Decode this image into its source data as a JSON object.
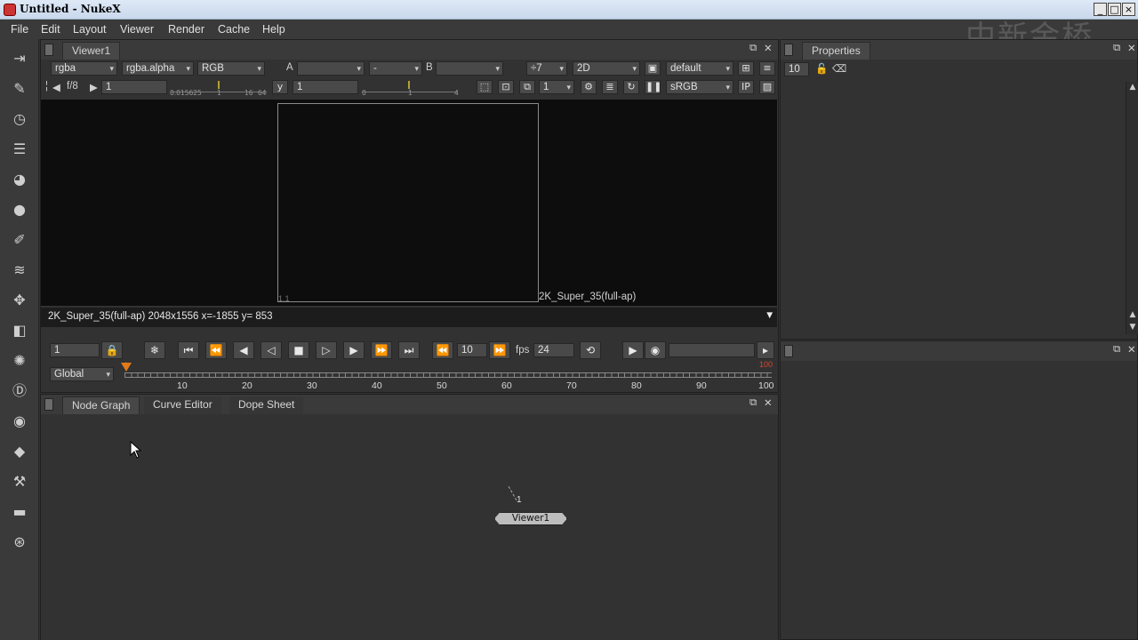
{
  "window": {
    "title": "Untitled - NukeX",
    "minimize": "_",
    "maximize": "□",
    "close": "×"
  },
  "watermark": "中新金桥",
  "menu": [
    "File",
    "Edit",
    "Layout",
    "Viewer",
    "Render",
    "Cache",
    "Help"
  ],
  "viewer": {
    "tab": "Viewer1",
    "channels": "rgba",
    "alpha_channel": "rgba.alpha",
    "display_channels": "RGB",
    "input_a_label": "A",
    "input_a_value": "",
    "composite_op": "-",
    "input_b_label": "B",
    "input_b_value": "",
    "proxy": "÷7",
    "view_mode": "2D",
    "lut_default": "default",
    "fstop": "f/8",
    "gain": "1",
    "gain_ticks": [
      "0.015625",
      "1",
      "16",
      "64"
    ],
    "gamma_label": "y",
    "gamma": "1",
    "gamma_ticks": [
      "0",
      "1",
      "4"
    ],
    "frame_ratio": "1",
    "colorspace": "sRGB",
    "ip_label": "IP",
    "origin_label": "1,1",
    "format_label": "2K_Super_35(full-ap)",
    "info_text": "2K_Super_35(full-ap) 2048x1556   x=-1855 y= 853"
  },
  "playback": {
    "frame": "1",
    "increment": "10",
    "fps_label": "fps",
    "fps": "24",
    "range_mode": "Global",
    "timeline_ticks": [
      "10",
      "20",
      "30",
      "40",
      "50",
      "60",
      "70",
      "80",
      "90",
      "100"
    ],
    "start_marker": "1",
    "end_marker": "100",
    "current_frame": 1,
    "frame_range": [
      1,
      100
    ]
  },
  "lower_tabs": [
    "Node Graph",
    "Curve Editor",
    "Dope Sheet"
  ],
  "node_graph": {
    "node_name": "Viewer1",
    "node_input": "1"
  },
  "properties": {
    "tab": "Properties",
    "max_panels": "10"
  },
  "toolbar_icons": [
    "image-icon",
    "draw-icon",
    "time-icon",
    "channel-icon",
    "color-icon",
    "filter-icon",
    "keyer-icon",
    "merge-icon",
    "transform-icon",
    "3d-icon",
    "particles-icon",
    "deep-icon",
    "views-icon",
    "metadata-icon",
    "other-icon",
    "toolsets-icon",
    "furnace-icon"
  ]
}
